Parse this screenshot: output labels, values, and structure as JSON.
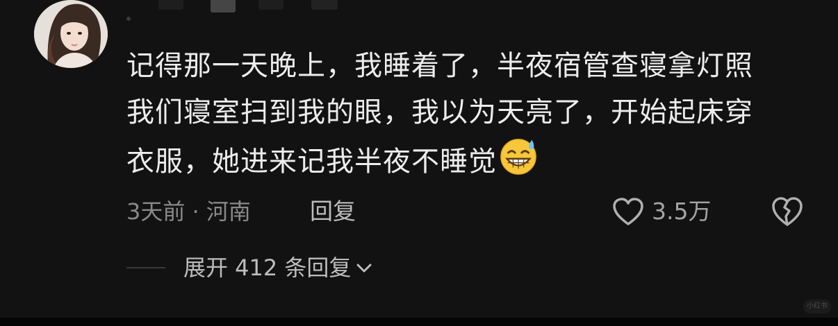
{
  "comment": {
    "lines": [
      "记得那一天晚上，我睡着了，半夜宿管查寝拿灯照",
      "我们寝室扫到我的眼，我以为天亮了，开始起床穿",
      "衣服，她进来记我半夜不睡觉"
    ],
    "emoji": "grinning-sweat-emoji",
    "time_location": "3天前 · 河南",
    "reply_label": "回复",
    "like_count": "3.5万",
    "expand_label": "展开 412 条回复"
  },
  "watermark": {
    "text": "小红书"
  },
  "colors": {
    "background": "#121212",
    "text": "#ededed",
    "meta": "#8a8a8a",
    "secondary": "#bdbdbd"
  },
  "icons": {
    "like": "heart-outline-icon",
    "dislike": "broken-heart-icon",
    "expand": "chevron-down-icon"
  }
}
